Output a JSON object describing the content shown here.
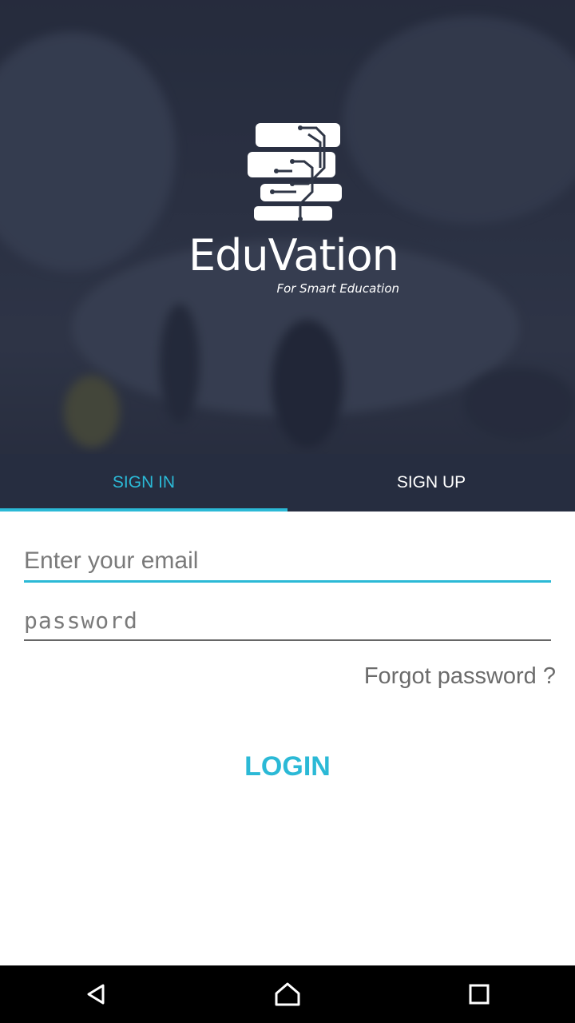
{
  "brand": {
    "name": "EduVation",
    "tagline": "For Smart Education"
  },
  "tabs": [
    {
      "label": "SIGN IN",
      "active": true
    },
    {
      "label": "SIGN UP",
      "active": false
    }
  ],
  "form": {
    "email_placeholder": "Enter your email",
    "email_value": "",
    "password_placeholder": "password",
    "password_value": "",
    "forgot_label": "Forgot password ?",
    "login_label": "LOGIN"
  },
  "navbar": {
    "icons": [
      "back-icon",
      "home-icon",
      "recents-icon"
    ]
  },
  "colors": {
    "accent": "#2bb9d6",
    "tab_bar": "#262d40",
    "hero_overlay": "#2b3142"
  }
}
